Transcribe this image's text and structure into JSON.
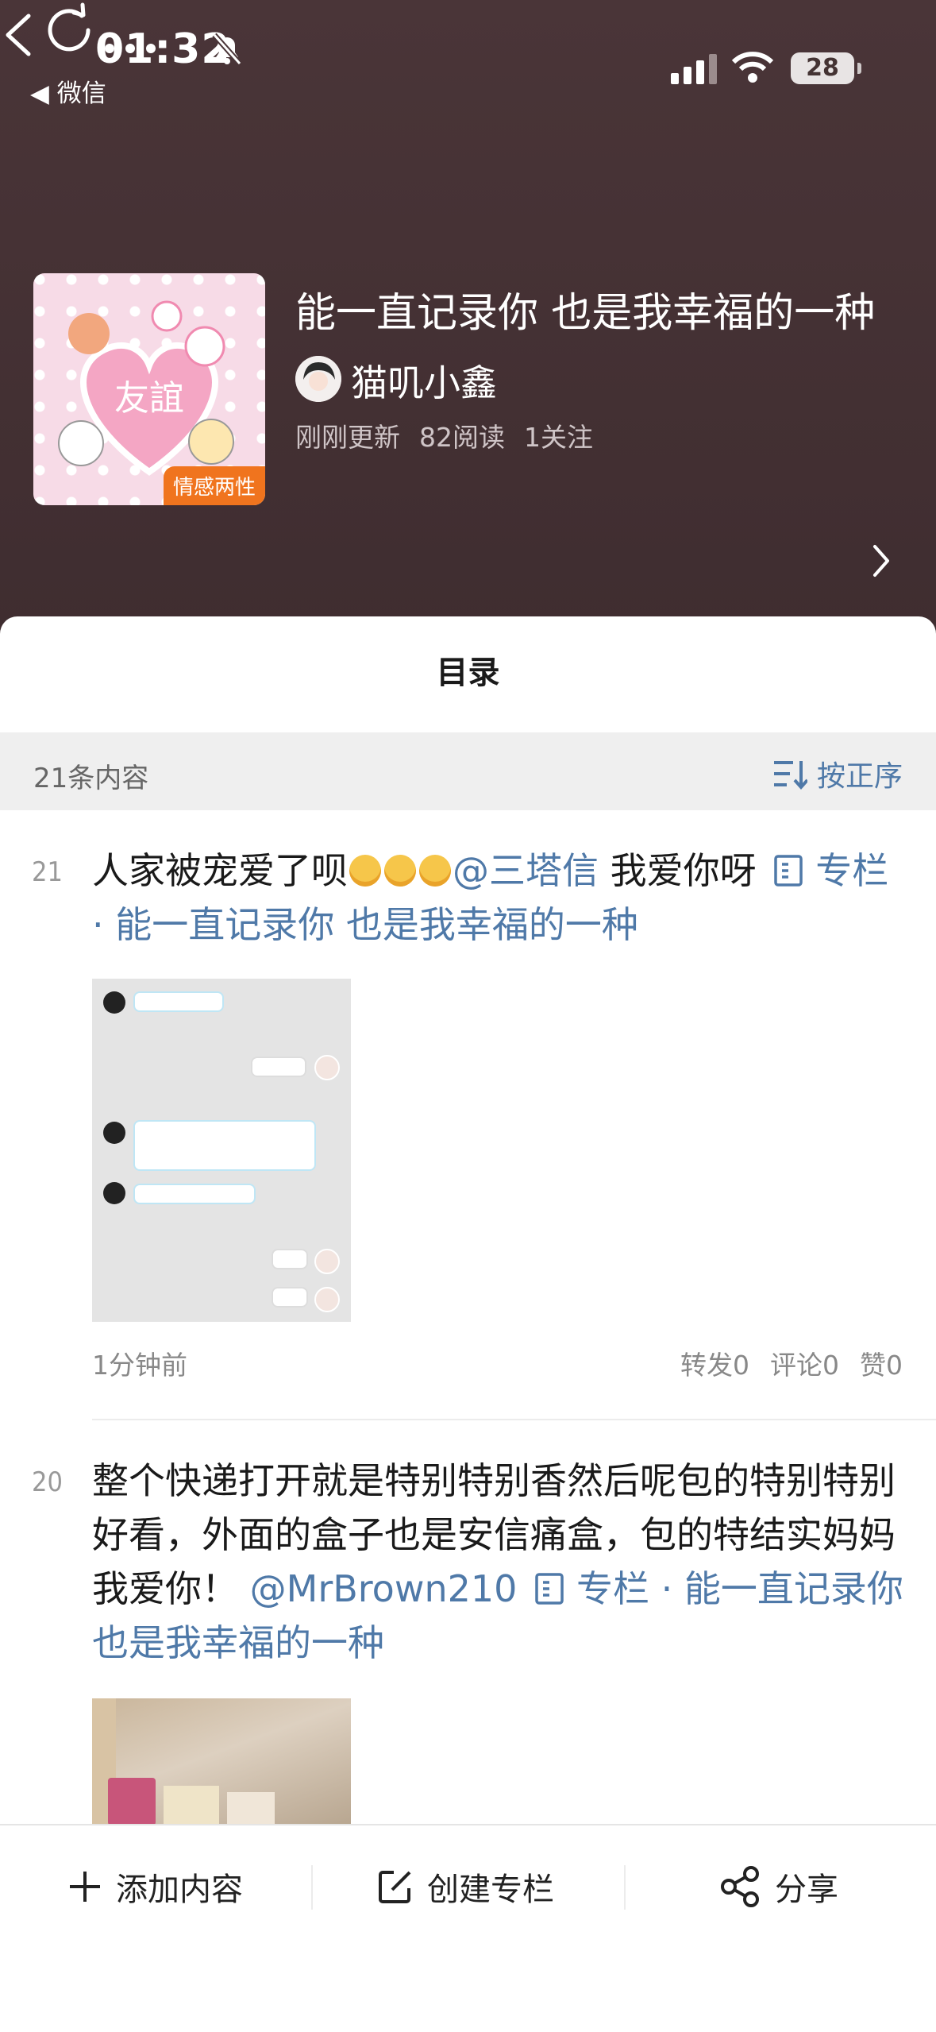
{
  "status_bar": {
    "time": "01:32",
    "back_app": "◀ 微信",
    "battery": "28"
  },
  "column": {
    "title": "能一直记录你 也是我幸福的一种",
    "author": "猫叽小鑫",
    "cover_tag": "情感两性",
    "cover_text": "友誼",
    "meta": {
      "updated": "刚刚更新",
      "reads": "82阅读",
      "follows": "1关注"
    }
  },
  "sheet": {
    "title": "目录",
    "count": "21条内容",
    "sort_label": "按正序"
  },
  "items": [
    {
      "num": "21",
      "text_a": "人家被宠爱了呗",
      "mention": "@三塔信",
      "text_b": " 我爱你呀 ",
      "column_link": "专栏 · 能一直记录你 也是我幸福的一种",
      "time": "1分钟前",
      "reposts": "转发0",
      "comments": "评论0",
      "likes": "赞0"
    },
    {
      "num": "20",
      "text_a": "整个快递打开就是特别特别香然后呢包的特别特别好看，外面的盒子也是安信痛盒，包的特结实妈妈我爱你！",
      "mention": "@MrBrown210",
      "column_link": "专栏 · 能一直记录你 也是我幸福的一种"
    }
  ],
  "bottom_bar": {
    "add": "添加内容",
    "create": "创建专栏",
    "share": "分享"
  },
  "colors": {
    "header_bg": "#4a3538",
    "link": "#4f79a8",
    "tag": "#f0741e"
  }
}
